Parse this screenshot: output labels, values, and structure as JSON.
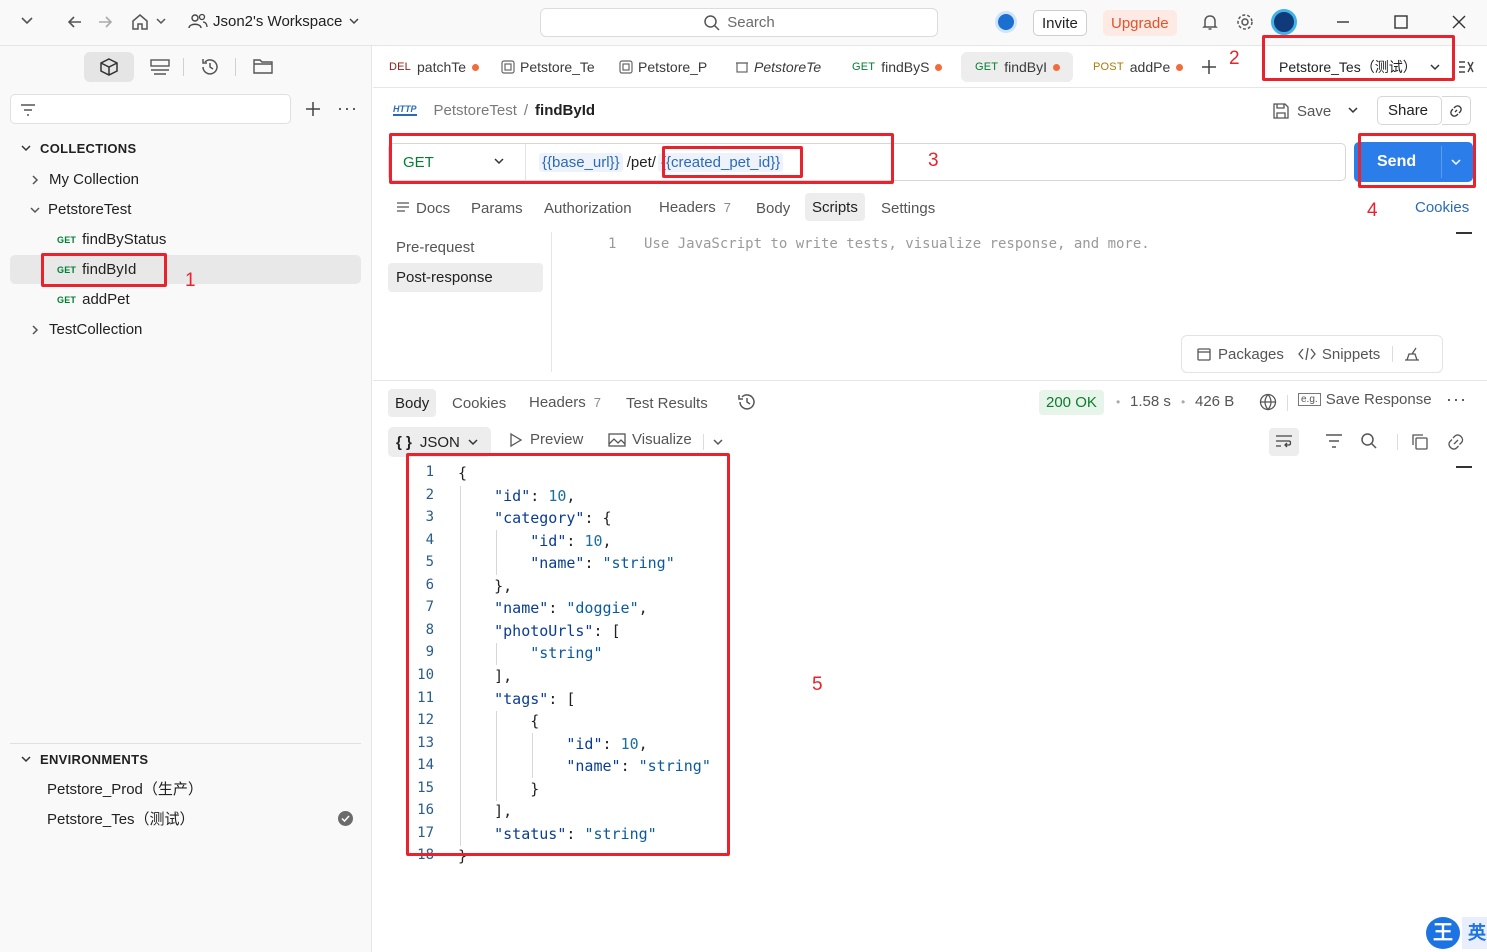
{
  "topbar": {
    "workspace": "Json2's Workspace",
    "search_placeholder": "Search",
    "invite": "Invite",
    "upgrade": "Upgrade"
  },
  "sidebar": {
    "collections_header": "COLLECTIONS",
    "collections": [
      {
        "label": "My Collection"
      },
      {
        "label": "PetstoreTest",
        "children": [
          {
            "method": "GET",
            "label": "findByStatus"
          },
          {
            "method": "GET",
            "label": "findById"
          },
          {
            "method": "GET",
            "label": "addPet"
          }
        ]
      },
      {
        "label": "TestCollection"
      }
    ],
    "environments_header": "ENVIRONMENTS",
    "environments": [
      {
        "label": "Petstore_Prod（生产）"
      },
      {
        "label": "Petstore_Tes（测试）"
      }
    ]
  },
  "tabs": [
    {
      "method": "DEL",
      "label": "patchTe"
    },
    {
      "method": "",
      "label": "Petstore_Te"
    },
    {
      "method": "",
      "label": "Petstore_P"
    },
    {
      "method": "",
      "label": "PetstoreTe"
    },
    {
      "method": "GET",
      "label": "findByS"
    },
    {
      "method": "GET",
      "label": "findByI"
    },
    {
      "method": "POST",
      "label": "addPe"
    }
  ],
  "env_selector": "Petstore_Tes（测试）",
  "breadcrumb": {
    "protocol": "HTTP",
    "collection": "PetstoreTest",
    "request": "findById"
  },
  "save_label": "Save",
  "share_label": "Share",
  "request": {
    "method": "GET",
    "url_var1": "{{base_url}}",
    "url_path": " /pet/",
    "url_var2": "{{created_pet_id}}",
    "send_label": "Send"
  },
  "request_tabs": {
    "docs": "Docs",
    "params": "Params",
    "authorization": "Authorization",
    "headers": "Headers",
    "headers_count": "7",
    "body": "Body",
    "scripts": "Scripts",
    "settings": "Settings",
    "cookies": "Cookies"
  },
  "scripts": {
    "pre_request": "Pre-request",
    "post_response": "Post-response",
    "line_number": "1",
    "placeholder": "Use JavaScript to write tests, visualize response, and more.",
    "packages": "Packages",
    "snippets": "Snippets"
  },
  "response_tabs": {
    "body": "Body",
    "cookies": "Cookies",
    "headers": "Headers",
    "headers_count": "7",
    "test_results": "Test Results"
  },
  "response_meta": {
    "status": "200 OK",
    "time": "1.58 s",
    "size": "426 B",
    "save_response": "Save Response"
  },
  "response_view": {
    "format": "JSON",
    "preview": "Preview",
    "visualize": "Visualize"
  },
  "response_body_lines": [
    "{",
    "    \"id\": 10,",
    "    \"category\": {",
    "        \"id\": 10,",
    "        \"name\": \"string\"",
    "    },",
    "    \"name\": \"doggie\",",
    "    \"photoUrls\": [",
    "        \"string\"",
    "    ],",
    "    \"tags\": [",
    "        {",
    "            \"id\": 10,",
    "            \"name\": \"string\"",
    "        }",
    "    ],",
    "    \"status\": \"string\"",
    "}"
  ],
  "annotations": [
    "1",
    "2",
    "3",
    "4",
    "5"
  ],
  "colors": {
    "send": "#2b7de9",
    "annotation": "#e8232d",
    "status_ok_bg": "#e6f4ea",
    "status_ok": "#0e7c2c"
  }
}
